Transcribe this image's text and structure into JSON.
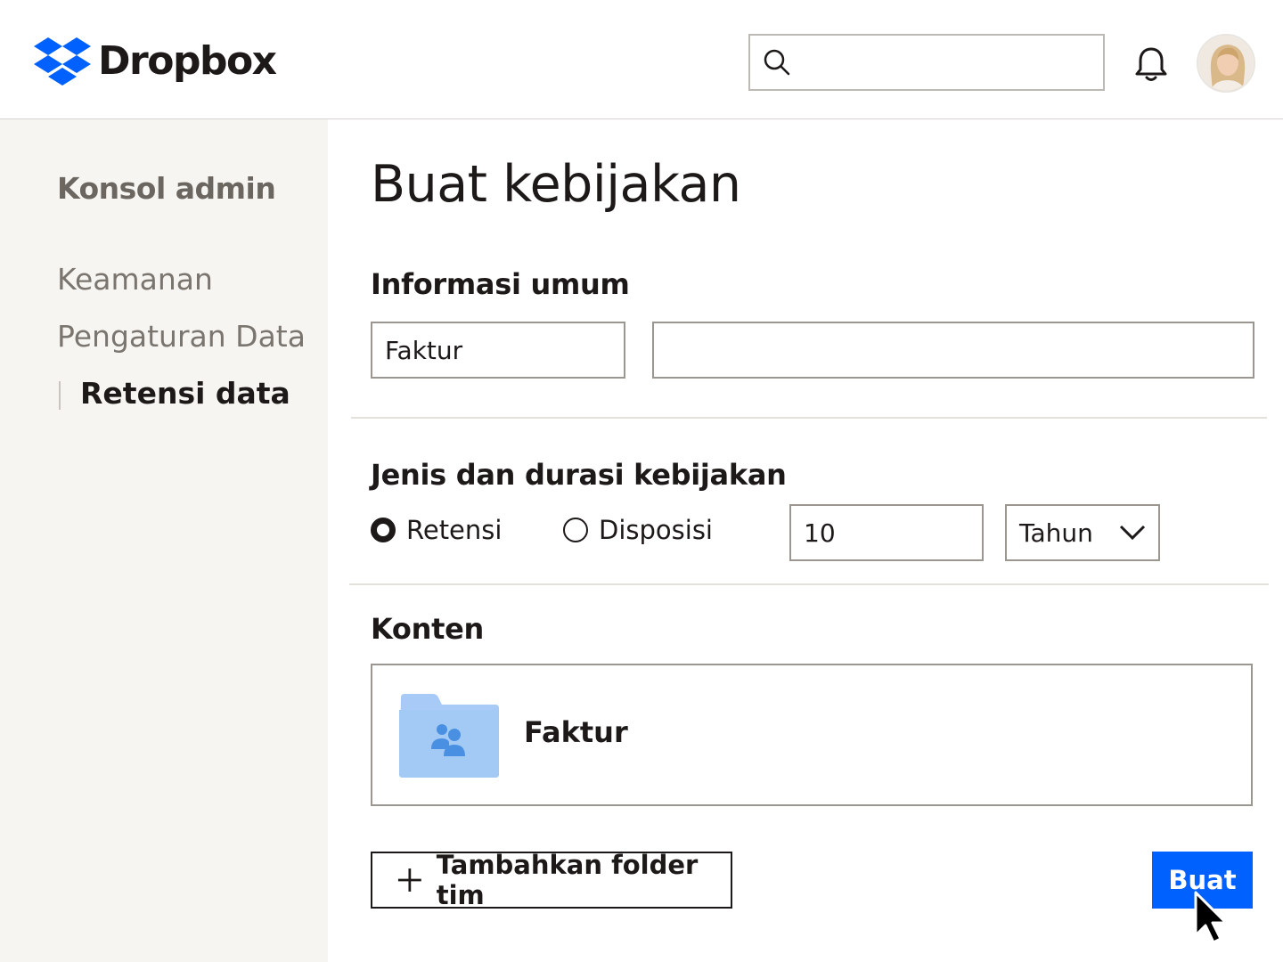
{
  "header": {
    "brand": "Dropbox",
    "search_placeholder": "",
    "brand_color": "#0061fe"
  },
  "sidebar": {
    "title": "Konsol admin",
    "items": [
      {
        "label": "Keamanan",
        "active": false
      },
      {
        "label": "Pengaturan Data",
        "active": false
      },
      {
        "label": "Retensi data",
        "active": true
      }
    ]
  },
  "main": {
    "page_title": "Buat kebijakan",
    "general": {
      "title": "Informasi umum",
      "name_value": "Faktur",
      "description_value": ""
    },
    "policy": {
      "title": "Jenis dan durasi kebijakan",
      "options": [
        {
          "label": "Retensi",
          "checked": true
        },
        {
          "label": "Disposisi",
          "checked": false
        }
      ],
      "duration_value": "10",
      "unit_selected": "Tahun"
    },
    "content": {
      "title": "Konten",
      "folder_name": "Faktur"
    },
    "actions": {
      "add_label": "Tambahkan folder tim",
      "create_label": "Buat"
    }
  }
}
